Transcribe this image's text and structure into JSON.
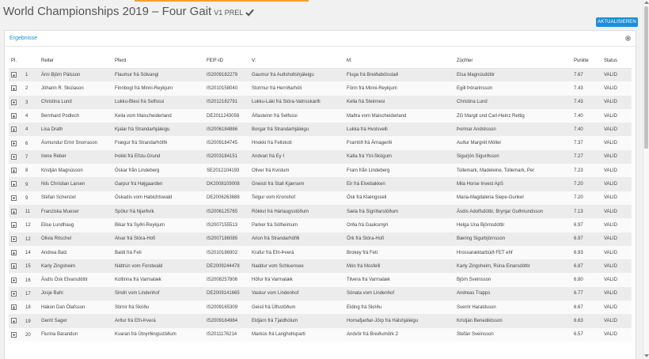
{
  "header": {
    "title": "World Championships 2019 – Four Gait",
    "suffix": "V1 PREL",
    "refresh_label": "AKTUALISIEREN"
  },
  "panel": {
    "title": "Ergebnisse"
  },
  "table": {
    "columns": [
      "Pl.",
      "Reiter",
      "Pferd",
      "FEIF-ID",
      "V:",
      "M:",
      "Züchter",
      "Punkte",
      "Status"
    ],
    "rows": [
      [
        "1",
        "Árni Björn Pálsson",
        "Flaumur frá Sólvangi",
        "IS2009182279",
        "Gaumur frá Auðsholtshjáleigu",
        "Fluga frá Breiðabólsstað",
        "Elsa Magnúsdóttir",
        "7.67",
        "VALID"
      ],
      [
        "2",
        "Jóhann R. Skúlason",
        "Finnbogi frá Minni-Reykjum",
        "IS2010158040",
        "Stormur frá Herríðarhóli",
        "Fönn frá Minni-Reykjum",
        "Egill Þórarinsson",
        "7.43",
        "VALID"
      ],
      [
        "3",
        "Christina Lund",
        "Lukku-Blesi frá Selfossi",
        "IS2012182791",
        "Lukku-Láki frá Stóra-Vatnsskarði",
        "Kella frá Steinnesi",
        "Christina Lund",
        "7.43",
        "VALID"
      ],
      [
        "4",
        "Bernhard Podlech",
        "Keila vom Maischeiderland",
        "DE2011243059",
        "Álfasteinn frá Selfossi",
        "Maðra vom Maischeiderland",
        "ZG Margit und Carl-Heinz Rettig",
        "7.40",
        "VALID"
      ],
      [
        "4",
        "Lisa Drath",
        "Kjalar frá Strandarhjáleigu",
        "IS2006184886",
        "Borgar frá Strandarhjáleigu",
        "Lukka frá Hvolsvelli",
        "Þormar Andrésson",
        "7.40",
        "VALID"
      ],
      [
        "6",
        "Ásmundur Ernir Snorrason",
        "Frægur frá Strandarhöfði",
        "IS2009184745",
        "Hnokki frá Fellskoti",
        "Framtíð frá Árnagerði",
        "Auður Margrét Möller",
        "7.37",
        "VALID"
      ],
      [
        "7",
        "Irene Reber",
        "Þokki frá Efstu-Grund",
        "IS2003184151",
        "Andvari frá Ey I",
        "Katla frá Ytri-Skógum",
        "Sigurjón Sigurðsson",
        "7.27",
        "VALID"
      ],
      [
        "8",
        "Kristján Magnússon",
        "Óskar från Lindeberg",
        "SE2012104193",
        "Oliver frá Kvistum",
        "Fram från Lindeberg",
        "Tollemark, Madeleine, Tollemark, Per",
        "7.23",
        "VALID"
      ],
      [
        "9",
        "Nils Christian Larsen",
        "Garpur frá Højgaarden",
        "DK2008109008",
        "Gneisti frá Stall Kjærsem",
        "Eir frá Elvebakken",
        "Mila Horse Invest ApS",
        "7.20",
        "VALID"
      ],
      [
        "9",
        "Stefan Schenzel",
        "Óskadís vom Habichtswald",
        "DE2006263688",
        "Telgur vom Kronshof",
        "Ósk frá Klængsseli",
        "Maria-Magdalena Siepe-Gunkel",
        "7.20",
        "VALID"
      ],
      [
        "11",
        "Franziska Mueser",
        "Spölur frá Njarðvík",
        "IS2006125765",
        "Rökkvi frá Hárlaugsstöðum",
        "Sæla frá Sigríðarstöðum",
        "Ásdís Adolfsdóttir, Brynjar Guðmundsson",
        "7.13",
        "VALID"
      ],
      [
        "12",
        "Elise Lundhaug",
        "Bikar frá Syðri-Reykjum",
        "IS2007155513",
        "Parker frá Sólheimum",
        "Orða frá Gauksmýri",
        "Helga Una Björnsdóttir",
        "6.97",
        "VALID"
      ],
      [
        "12",
        "Olivia Ritschel",
        "Alvar frá Stóra-Hofi",
        "IS2007186085",
        "Arion frá Strandarhöfði",
        "Örk frá Stóra-Hofi",
        "Bæring Sigurbjörnsson",
        "6.97",
        "VALID"
      ],
      [
        "14",
        "Andrea Balz",
        "Baldi frá Feti",
        "IS2010186902",
        "Krafur frá Efri-Þverá",
        "Brokey frá Feti",
        "Hrossaræktarbúið FET ehf",
        "6.93",
        "VALID"
      ],
      [
        "15",
        "Karly Zingsheim",
        "Náttrún vom Forstwald",
        "DE2009244478",
        "Naddur vom Schluensee",
        "Món frá Mosfelli",
        "Karly Zingsheim, Rúna Einarsdóttir",
        "6.87",
        "VALID"
      ],
      [
        "16",
        "Ásdís Ósk Elvarsdóttir",
        "Koltinna frá Varmalæk",
        "IS2008257806",
        "Höfur frá Varmalæk",
        "Tilvera frá Varmalæk",
        "Björn Sveinsson",
        "6.80",
        "VALID"
      ],
      [
        "17",
        "Josje Bahl",
        "Sindri vom Lindenhof",
        "DE2009141665",
        "Vaskur vom Lindenhof",
        "Sónata vom Lindenhof",
        "Andreas Trapps",
        "6.77",
        "VALID"
      ],
      [
        "18",
        "Hákon Dan Ólafsson",
        "Stirnir frá Skriðu",
        "IS2009165309",
        "Geisli frá Úlfsstöðum",
        "Elding frá Skriðu",
        "Sverrir Haraldsson",
        "6.67",
        "VALID"
      ],
      [
        "19",
        "Gerrit Sager",
        "Arður frá Efri-Þverá",
        "IS2009184984",
        "Eldjárn frá Tjaldhólum",
        "Hornafjarðar-Jörp frá Hálshjáleigu",
        "Kristján Benediktsson",
        "6.63",
        "VALID"
      ],
      [
        "20",
        "Flurina Barandun",
        "Kvaran frá Útnyrðingsstöðum",
        "IS2011176214",
        "Markús frá Langholtsparti",
        "Andvör frá Breiðumörk 2",
        "Stefán Sveinsson",
        "6.57",
        "VALID"
      ]
    ]
  },
  "icons": {
    "check": "check-icon",
    "settings": "gear-icon",
    "expand": "plus-square-icon"
  },
  "colors": {
    "accent": "#1a8fd8",
    "top_bar": "#f0a030"
  }
}
